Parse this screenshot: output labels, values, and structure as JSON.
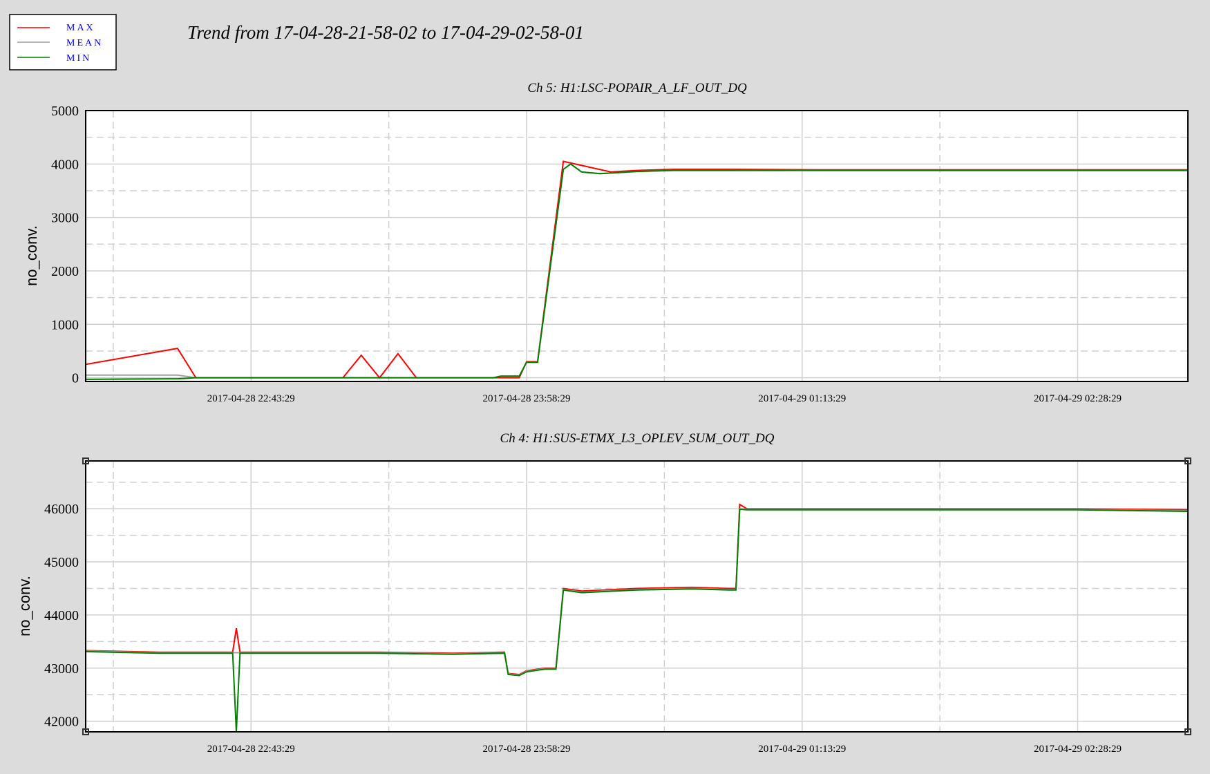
{
  "title": "Trend from 17-04-28-21-58-02 to 17-04-29-02-58-01",
  "legend": {
    "items": [
      {
        "label": "MAX",
        "color": "#ff0000"
      },
      {
        "label": "MEAN",
        "color": "#a0a0a0"
      },
      {
        "label": "MIN",
        "color": "#008000"
      }
    ],
    "label_color": "#0000ff"
  },
  "colors": {
    "background": "#dcdcdc",
    "plot_background": "#ffffff",
    "grid": "#cfcfcf",
    "max": "#ff0000",
    "mean": "#a0a0a0",
    "min": "#008000"
  },
  "chart_data": [
    {
      "type": "line",
      "title": "Ch 5: H1:LSC-POPAIR_A_LF_OUT_DQ",
      "ylabel": "no_conv.",
      "xlabel": "",
      "x_ticks": [
        "2017-04-28 22:43:29",
        "2017-04-28 23:58:29",
        "2017-04-29 01:13:29",
        "2017-04-29 02:28:29"
      ],
      "x_range_minutes": [
        0,
        300
      ],
      "x_tick_minutes": [
        45,
        120,
        195,
        270
      ],
      "y_ticks": [
        0,
        1000,
        2000,
        3000,
        4000,
        5000
      ],
      "ylim": [
        -70,
        5000
      ],
      "grid": true,
      "series": [
        {
          "name": "MAX",
          "x": [
            0,
            25,
            30,
            60,
            70,
            75,
            80,
            85,
            90,
            105,
            111,
            113,
            118,
            120,
            123,
            130,
            143,
            145,
            150,
            160,
            175,
            200,
            250,
            300
          ],
          "y": [
            250,
            550,
            0,
            0,
            0,
            420,
            0,
            450,
            0,
            0,
            0,
            0,
            0,
            300,
            300,
            4050,
            3850,
            3860,
            3880,
            3900,
            3900,
            3890,
            3890,
            3890
          ]
        },
        {
          "name": "MEAN",
          "x": [
            0,
            25,
            30,
            60,
            90,
            111,
            113,
            118,
            120,
            123,
            130,
            132,
            135,
            140,
            145,
            150,
            160,
            175,
            200,
            250,
            300
          ],
          "y": [
            50,
            50,
            0,
            0,
            0,
            0,
            30,
            30,
            290,
            290,
            3900,
            4000,
            3850,
            3820,
            3840,
            3860,
            3880,
            3880,
            3880,
            3880,
            3880
          ]
        },
        {
          "name": "MIN",
          "x": [
            0,
            25,
            30,
            60,
            90,
            111,
            113,
            118,
            120,
            123,
            130,
            132,
            135,
            140,
            145,
            150,
            160,
            175,
            200,
            250,
            300
          ],
          "y": [
            -30,
            -20,
            0,
            0,
            0,
            0,
            30,
            30,
            290,
            290,
            3900,
            4000,
            3850,
            3820,
            3840,
            3860,
            3880,
            3880,
            3880,
            3880,
            3880
          ]
        }
      ]
    },
    {
      "type": "line",
      "title": "Ch 4: H1:SUS-ETMX_L3_OPLEV_SUM_OUT_DQ",
      "ylabel": "no_conv.",
      "xlabel": "",
      "x_ticks": [
        "2017-04-28 22:43:29",
        "2017-04-28 23:58:29",
        "2017-04-29 01:13:29",
        "2017-04-29 02:28:29"
      ],
      "x_range_minutes": [
        0,
        300
      ],
      "x_tick_minutes": [
        45,
        120,
        195,
        270
      ],
      "y_ticks": [
        42000,
        43000,
        44000,
        45000,
        46000
      ],
      "ylim": [
        41800,
        46900
      ],
      "grid": true,
      "series": [
        {
          "name": "MAX",
          "x": [
            0,
            20,
            40,
            41,
            42,
            60,
            80,
            100,
            114,
            115,
            118,
            120,
            125,
            128,
            130,
            135,
            150,
            165,
            175,
            177,
            178,
            180,
            200,
            240,
            270,
            300
          ],
          "y": [
            43330,
            43300,
            43300,
            43750,
            43300,
            43300,
            43300,
            43280,
            43300,
            42900,
            42880,
            42950,
            43000,
            43000,
            44500,
            44450,
            44500,
            44520,
            44500,
            44500,
            46080,
            46000,
            46000,
            46000,
            46000,
            45980
          ]
        },
        {
          "name": "MEAN",
          "x": [
            0,
            20,
            40,
            60,
            80,
            100,
            114,
            115,
            118,
            120,
            125,
            128,
            130,
            135,
            150,
            165,
            175,
            177,
            178,
            180,
            200,
            240,
            270,
            300
          ],
          "y": [
            43320,
            43290,
            43290,
            43290,
            43290,
            43270,
            43290,
            42890,
            42870,
            42940,
            42990,
            42990,
            44480,
            44430,
            44480,
            44500,
            44480,
            44480,
            46000,
            45990,
            45990,
            45990,
            45990,
            45960
          ]
        },
        {
          "name": "MIN",
          "x": [
            0,
            20,
            40,
            41,
            42,
            60,
            80,
            100,
            114,
            115,
            118,
            120,
            125,
            128,
            130,
            135,
            150,
            165,
            175,
            177,
            178,
            180,
            200,
            240,
            270,
            300
          ],
          "y": [
            43310,
            43280,
            43280,
            41800,
            43280,
            43280,
            43280,
            43260,
            43280,
            42880,
            42860,
            42930,
            42980,
            42980,
            44470,
            44420,
            44470,
            44490,
            44470,
            44470,
            45990,
            45980,
            45980,
            45980,
            45980,
            45950
          ]
        }
      ]
    }
  ]
}
